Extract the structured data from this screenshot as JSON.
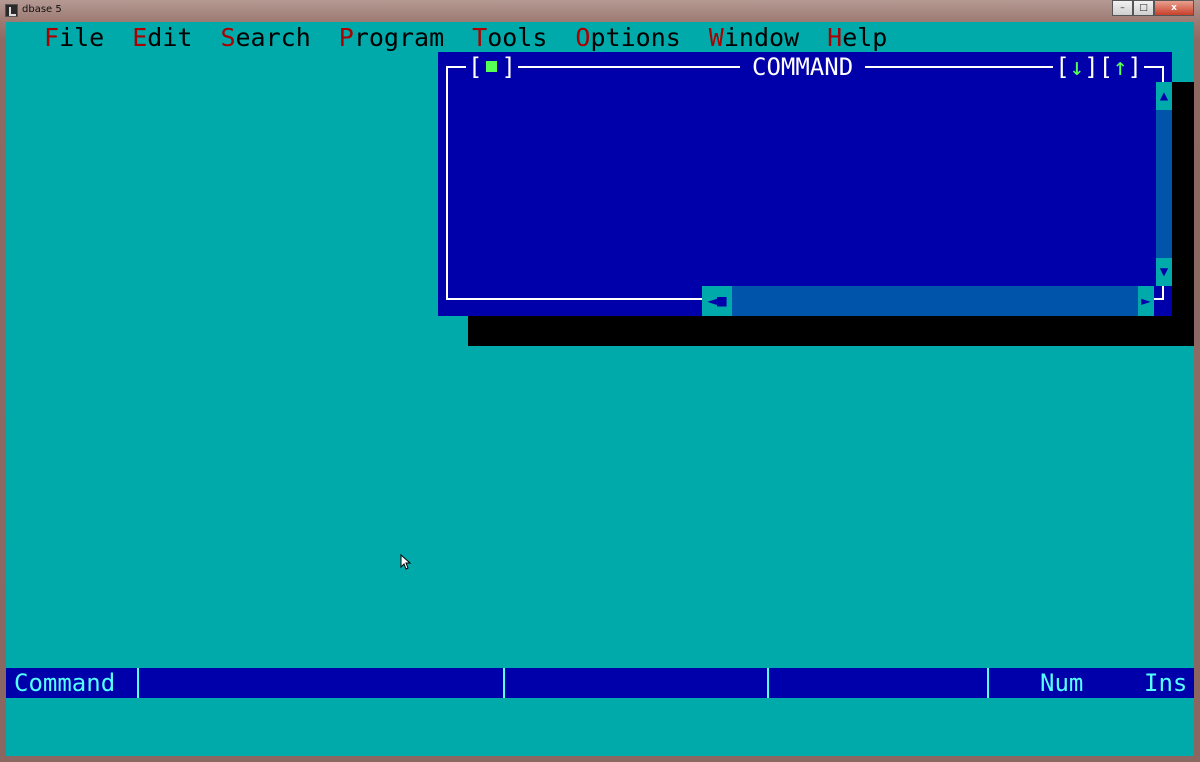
{
  "window": {
    "title": "dbase 5",
    "controls": {
      "minimize": "–",
      "maximize": "□",
      "close": "x"
    }
  },
  "menu": {
    "items": [
      {
        "hot": "F",
        "rest": "ile"
      },
      {
        "hot": "E",
        "rest": "dit"
      },
      {
        "hot": "S",
        "rest": "earch"
      },
      {
        "hot": "P",
        "rest": "rogram"
      },
      {
        "hot": "T",
        "rest": "ools"
      },
      {
        "hot": "O",
        "rest": "ptions"
      },
      {
        "hot": "W",
        "rest": "indow"
      },
      {
        "hot": "H",
        "rest": "elp"
      }
    ]
  },
  "command_window": {
    "title": "COMMAND",
    "close_open": "[",
    "close_close": "]",
    "zoom_down": "↓",
    "zoom_up": "↑",
    "scroll_up": "▲",
    "scroll_down": "▼",
    "scroll_left": "◄■",
    "scroll_right": "►"
  },
  "status_bar": {
    "mode": "Command",
    "num": "Num",
    "ins": "Ins"
  },
  "colors": {
    "desktop": "#00aaaa",
    "window_bg": "#0000aa",
    "hotkey": "#aa0000",
    "status_text": "#55ffff",
    "accent_green": "#55ff55"
  }
}
